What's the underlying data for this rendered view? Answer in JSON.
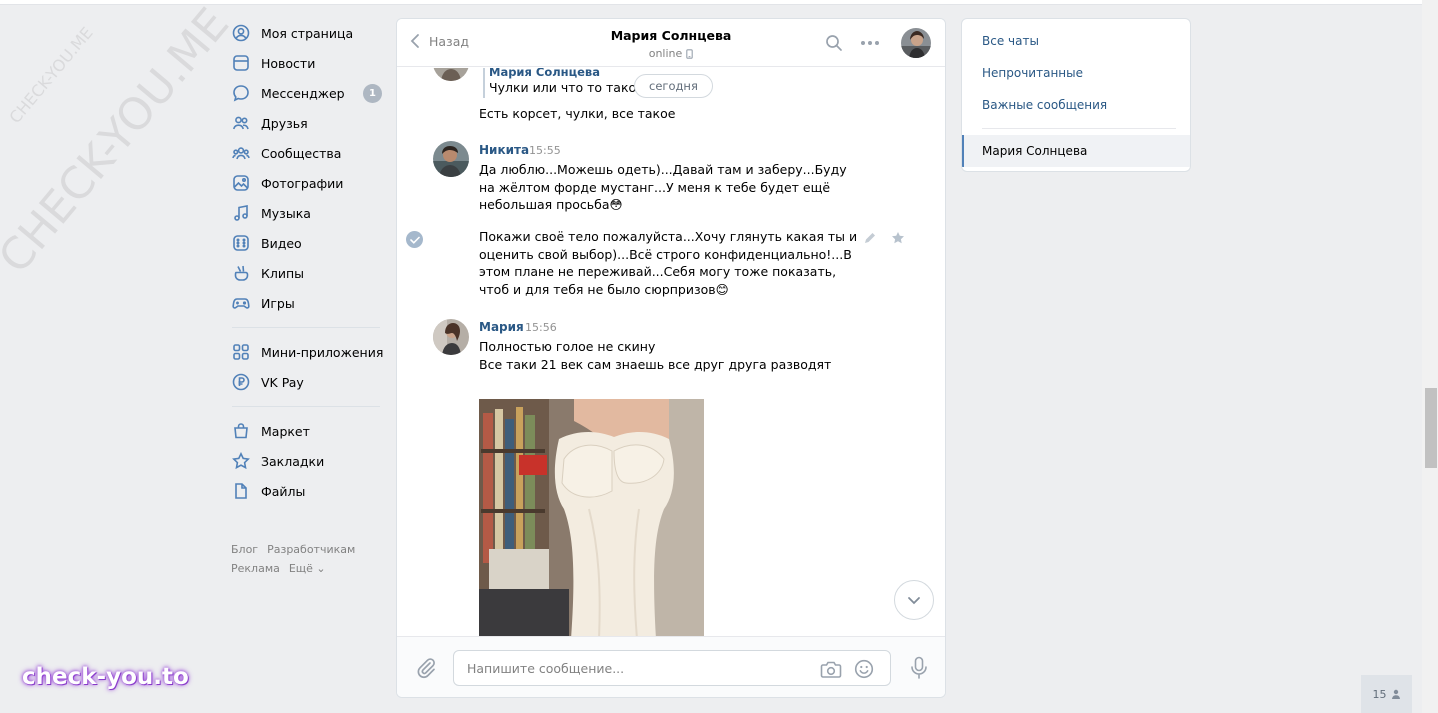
{
  "sidebar": {
    "items": [
      {
        "label": "Моя страница",
        "icon": "user-circle-icon"
      },
      {
        "label": "Новости",
        "icon": "newspaper-icon"
      },
      {
        "label": "Мессенджер",
        "icon": "chat-bubble-icon",
        "badge": "1"
      },
      {
        "label": "Друзья",
        "icon": "friends-icon"
      },
      {
        "label": "Сообщества",
        "icon": "communities-icon"
      },
      {
        "label": "Фотографии",
        "icon": "photo-icon"
      },
      {
        "label": "Музыка",
        "icon": "music-note-icon"
      },
      {
        "label": "Видео",
        "icon": "video-icon"
      },
      {
        "label": "Клипы",
        "icon": "clips-icon"
      },
      {
        "label": "Игры",
        "icon": "gamepad-icon"
      }
    ],
    "items2": [
      {
        "label": "Мини-приложения",
        "icon": "grid-icon"
      },
      {
        "label": "VK Pay",
        "icon": "ruble-icon"
      }
    ],
    "items3": [
      {
        "label": "Маркет",
        "icon": "bag-icon"
      },
      {
        "label": "Закладки",
        "icon": "star-icon"
      },
      {
        "label": "Файлы",
        "icon": "file-icon"
      }
    ],
    "footer": {
      "blog": "Блог",
      "dev": "Разработчикам",
      "ads": "Реклама",
      "more": "Ещё ⌄"
    }
  },
  "chat": {
    "back": "Назад",
    "peer_name": "Мария Солнцева",
    "peer_status": "online",
    "reply_author": "Мария Солнцева",
    "reply_text": "Чулки или что то такое",
    "date_pill": "сегодня",
    "messages": {
      "m1_text": "Есть корсет, чулки, все такое",
      "m2_author": "Никита",
      "m2_time": "15:55",
      "m2_text": "Да люблю...Можешь одеть)...Давай там и заберу...Буду на жёлтом форде мустанг...У меня к тебе будет ещё небольшая просьба😳",
      "m3_text": "Покажи своё тело пожалуйста...Хочу глянуть какая ты и оценить свой выбор)...Всё строго конфиденциально!...В этом плане не переживай...Себя могу тоже показать, чтоб и для тебя не было сюрпризов😊",
      "m4_author": "Мария",
      "m4_time": "15:56",
      "m4_line1": "Полностью голое не скину",
      "m4_line2": "Все таки 21 век сам знаешь все друг друга разводят"
    },
    "composer_placeholder": "Напишите сообщение..."
  },
  "right_panel": {
    "all": "Все чаты",
    "unread": "Непрочитанные",
    "important": "Важные сообщения",
    "active_chat": "Мария Солнцева"
  },
  "online_count": "15",
  "watermark_big": "CHECK-YOU.ME",
  "watermark_small": "CHECK-YOU.ME",
  "brand_watermark": "check-you.to",
  "colors": {
    "accent": "#2a5885",
    "link": "#2a5885",
    "nav_icon": "#5181b8",
    "badge": "#aeb7c2",
    "background": "#edeef0"
  }
}
